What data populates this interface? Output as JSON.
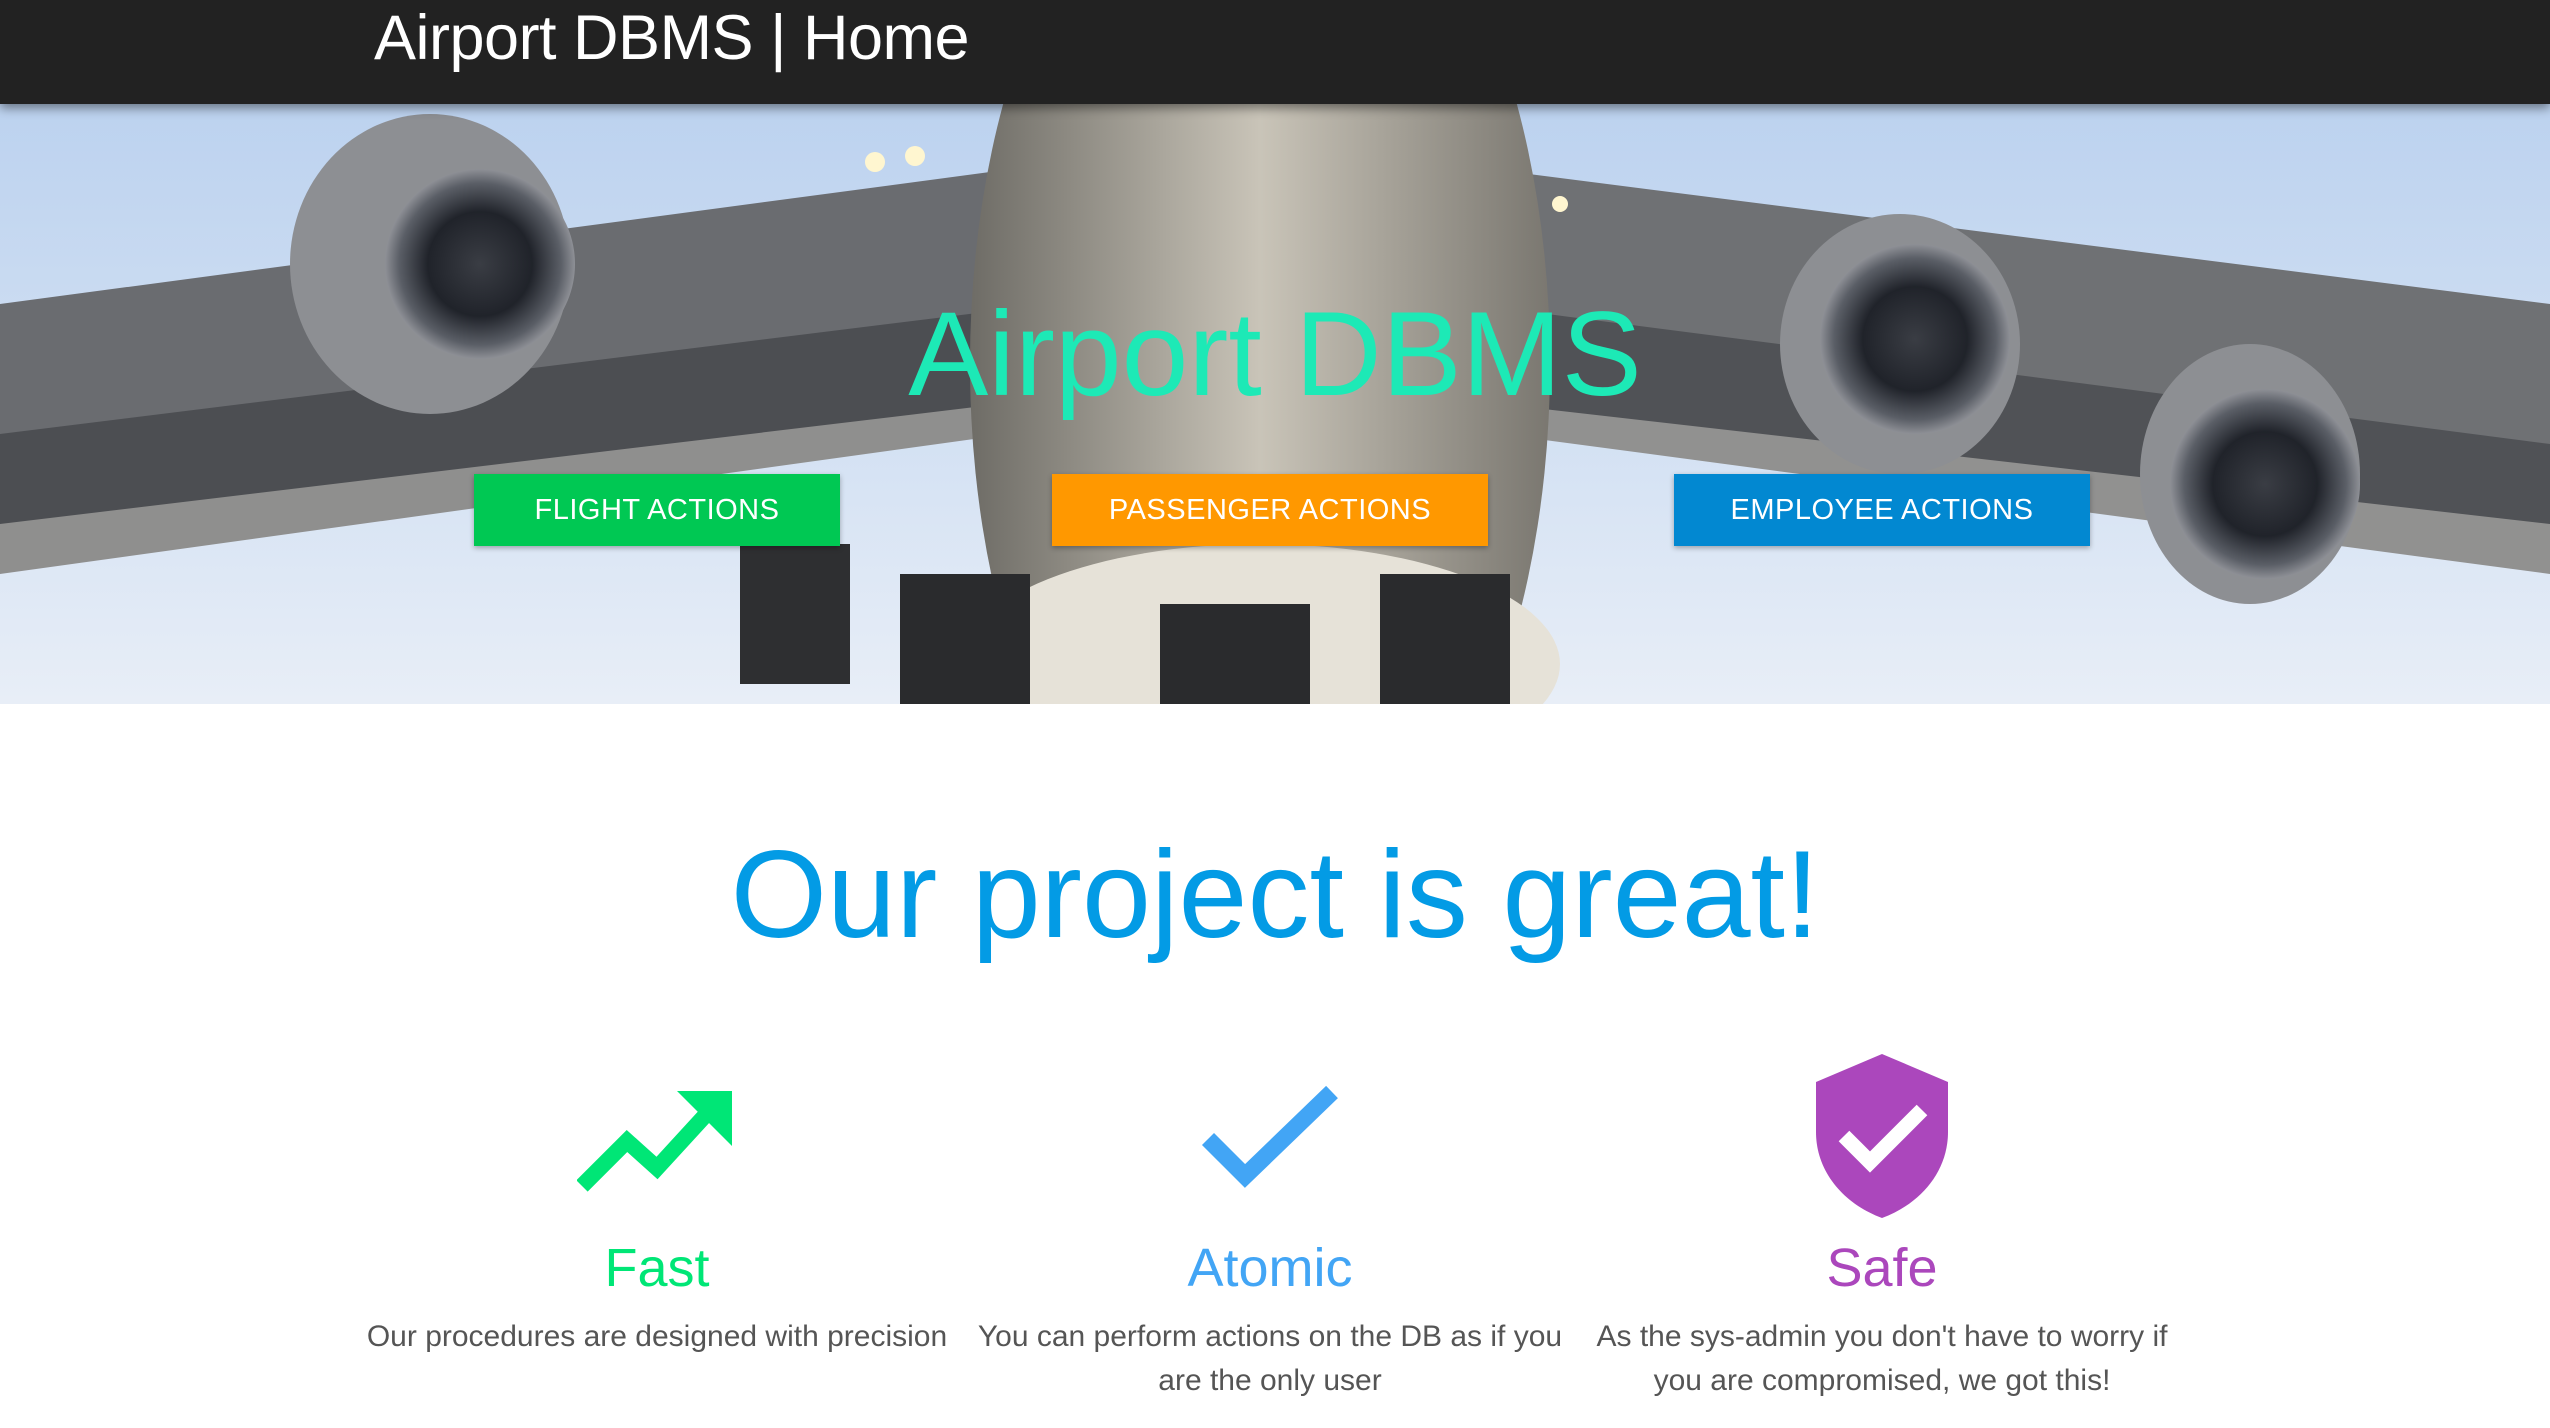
{
  "navbar": {
    "brand": "Airport DBMS | Home"
  },
  "hero": {
    "title": "Airport DBMS",
    "title_color": "#1de9b6",
    "buttons": [
      {
        "label": "FLIGHT ACTIONS",
        "color": "#00c853"
      },
      {
        "label": "PASSENGER ACTIONS",
        "color": "#ff9800"
      },
      {
        "label": "EMPLOYEE ACTIONS",
        "color": "#0288d1"
      }
    ]
  },
  "features_section": {
    "title": "Our project is great!",
    "title_color": "#039be5",
    "items": [
      {
        "icon": "trending-up-icon",
        "title": "Fast",
        "text": "Our procedures are designed with precision",
        "color": "#00e676"
      },
      {
        "icon": "check-icon",
        "title": "Atomic",
        "text": "You can perform actions on the DB as if you are the only user",
        "color": "#42a5f5"
      },
      {
        "icon": "shield-check-icon",
        "title": "Safe",
        "text": "As the sys-admin you don't have to worry if you are compromised, we got this!",
        "color": "#ab47bc"
      }
    ]
  }
}
